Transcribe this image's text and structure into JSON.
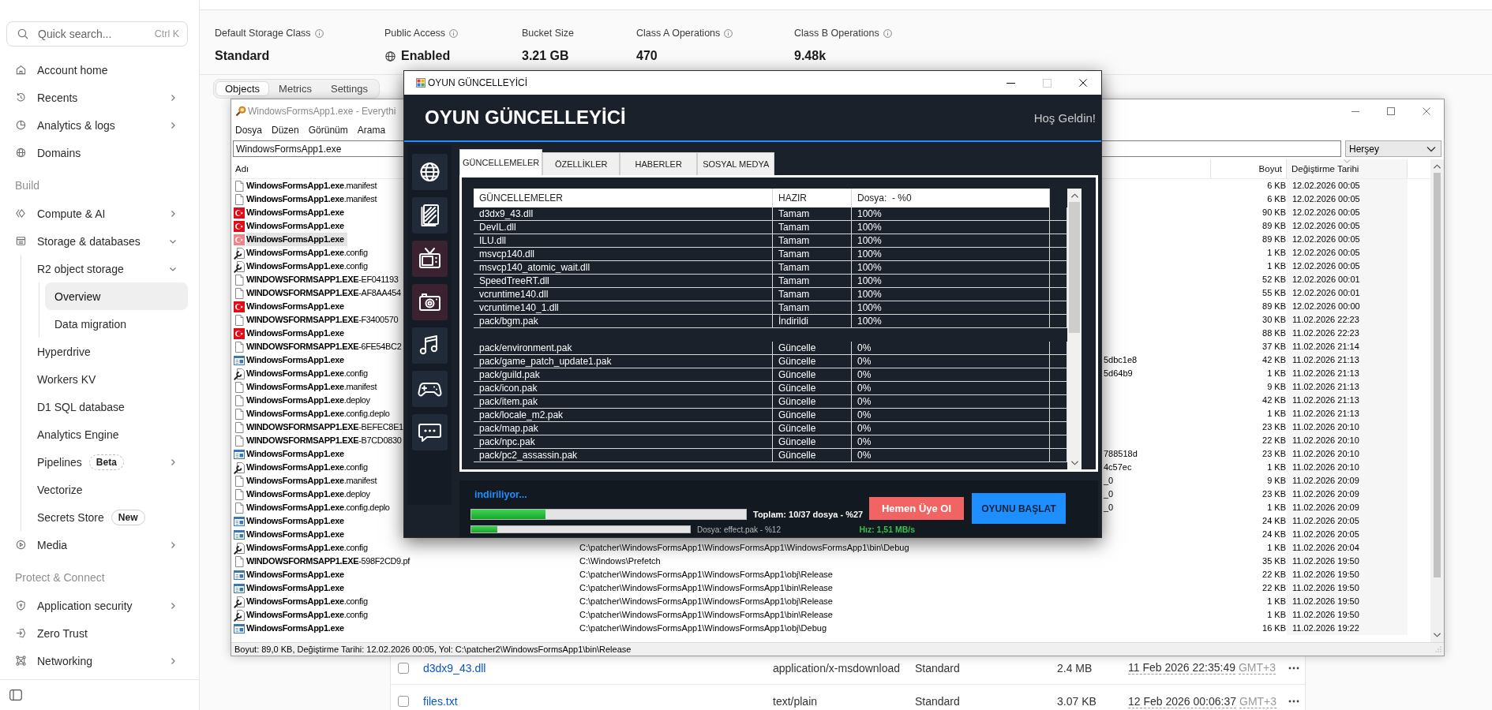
{
  "sidebar": {
    "search": {
      "placeholder": "Quick search...",
      "shortcut": "Ctrl K"
    },
    "sections": [
      {
        "items": [
          {
            "label": "Account home",
            "selected": false
          },
          {
            "label": "Recents",
            "selected": false,
            "expanded": false
          },
          {
            "label": "Analytics & logs",
            "selected": false,
            "expanded": false
          },
          {
            "label": "Domains",
            "selected": false
          }
        ]
      },
      {
        "heading": "Build",
        "items": [
          {
            "label": "Compute & AI",
            "selected": false,
            "expanded": false
          },
          {
            "label": "Storage & databases",
            "selected": false,
            "expanded": true,
            "children": [
              {
                "label": "R2 object storage",
                "selected": false,
                "expanded": true,
                "children": [
                  {
                    "label": "Overview",
                    "selected": true
                  },
                  {
                    "label": "Data migration",
                    "selected": false
                  }
                ]
              },
              {
                "label": "Hyperdrive",
                "selected": false
              },
              {
                "label": "Workers KV",
                "selected": false
              },
              {
                "label": "D1 SQL database",
                "selected": false
              },
              {
                "label": "Analytics Engine",
                "selected": false
              },
              {
                "label": "Pipelines",
                "selected": false,
                "expanded": false,
                "badge": {
                  "label": "Beta",
                  "kind": "dashed"
                }
              },
              {
                "label": "Vectorize",
                "selected": false
              },
              {
                "label": "Secrets Store",
                "selected": false,
                "badge": {
                  "label": "New",
                  "kind": "solid"
                }
              }
            ]
          },
          {
            "label": "Media",
            "selected": false,
            "expanded": false
          }
        ]
      },
      {
        "heading": "Protect & Connect",
        "items": [
          {
            "label": "Application security",
            "selected": false,
            "expanded": false
          },
          {
            "label": "Zero Trust",
            "selected": false
          },
          {
            "label": "Networking",
            "selected": false,
            "expanded": false
          }
        ]
      }
    ]
  },
  "main": {
    "stats": [
      {
        "label": "Default Storage Class",
        "info": true,
        "kind": "metric",
        "value": "Standard"
      },
      {
        "label": "Public Access",
        "info": true,
        "kind": "status",
        "value": "Enabled"
      },
      {
        "label": "Bucket Size",
        "info": false,
        "kind": "metric",
        "value": "3.21 GB"
      },
      {
        "label": "Class A Operations",
        "info": true,
        "kind": "metric",
        "value": "470"
      },
      {
        "label": "Class B Operations",
        "info": true,
        "kind": "metric",
        "value": "9.48k"
      }
    ],
    "tabs": [
      {
        "label": "Objects",
        "selected": true
      },
      {
        "label": "Metrics",
        "selected": false
      },
      {
        "label": "Settings",
        "selected": false
      }
    ],
    "objects": [
      {
        "checked": false,
        "name": "d3dx9_43.dll",
        "type": "application/x-msdownload",
        "storage_class": "Standard",
        "size": "2.4 MB",
        "modified": "11 Feb 2026 22:35:49",
        "timezone": "GMT+3"
      },
      {
        "checked": false,
        "name": "files.txt",
        "type": "text/plain",
        "storage_class": "Standard",
        "size": "3.07 KB",
        "modified": "12 Feb 2026 00:06:37",
        "timezone": "GMT+3"
      }
    ]
  },
  "everything_window": {
    "title": "WindowsFormsApp1.exe - Everythi",
    "menu": [
      "Dosya",
      "Düzen",
      "Görünüm",
      "Arama"
    ],
    "search": {
      "value": "WindowsFormsApp1.exe"
    },
    "filter": {
      "value": "Herşey"
    },
    "columns": [
      {
        "label": "Adı",
        "sorted": false
      },
      {
        "label": "Boyut",
        "sorted": false
      },
      {
        "label": "Değiştirme Tarihi",
        "sorted": true
      }
    ],
    "rows": [
      {
        "kind": "file",
        "name": "**WindowsFormsApp1.exe**.manifest",
        "all_bold": false,
        "size": "6 KB",
        "modified": "12.02.2026 00:05",
        "selected": false
      },
      {
        "kind": "file",
        "name": "**WindowsFormsApp1.exe**.manifest",
        "all_bold": false,
        "size": "6 KB",
        "modified": "12.02.2026 00:05",
        "selected": false
      },
      {
        "kind": "flag",
        "name": "WindowsFormsApp1.exe",
        "all_bold": true,
        "size": "90 KB",
        "modified": "12.02.2026 00:05",
        "selected": false
      },
      {
        "kind": "flag",
        "name": "WindowsFormsApp1.exe",
        "all_bold": true,
        "size": "89 KB",
        "modified": "12.02.2026 00:05",
        "selected": false
      },
      {
        "kind": "flag",
        "name": "WindowsFormsApp1.exe",
        "all_bold": true,
        "size": "89 KB",
        "modified": "12.02.2026 00:05",
        "selected": true
      },
      {
        "kind": "config",
        "name": "**WindowsFormsApp1.exe**.config",
        "all_bold": false,
        "size": "1 KB",
        "modified": "12.02.2026 00:05",
        "selected": false
      },
      {
        "kind": "config",
        "name": "**WindowsFormsApp1.exe**.config",
        "all_bold": false,
        "size": "1 KB",
        "modified": "12.02.2026 00:05",
        "selected": false
      },
      {
        "kind": "file",
        "name": "**WINDOWSFORMSAPP1.EXE**-EF041193",
        "all_bold": false,
        "size": "52 KB",
        "modified": "12.02.2026 00:01",
        "selected": false
      },
      {
        "kind": "file",
        "name": "**WINDOWSFORMSAPP1.EXE**-AF8AA454",
        "all_bold": false,
        "size": "55 KB",
        "modified": "12.02.2026 00:01",
        "selected": false
      },
      {
        "kind": "flag",
        "name": "WindowsFormsApp1.exe",
        "all_bold": true,
        "size": "89 KB",
        "modified": "12.02.2026 00:00",
        "selected": false
      },
      {
        "kind": "file",
        "name": "**WINDOWSFORMSAPP1.EXE**-F3400570",
        "all_bold": false,
        "size": "30 KB",
        "modified": "11.02.2026 22:23",
        "selected": false
      },
      {
        "kind": "flag",
        "name": "WindowsFormsApp1.exe",
        "all_bold": true,
        "size": "88 KB",
        "modified": "11.02.2026 22:23",
        "selected": false
      },
      {
        "kind": "file",
        "name": "**WINDOWSFORMSAPP1.EXE**-6FE54BC2",
        "all_bold": false,
        "size": "37 KB",
        "modified": "11.02.2026 21:14",
        "selected": false
      },
      {
        "kind": "app",
        "name": "WindowsFormsApp1.exe",
        "all_bold": true,
        "path_end": "5dbc1e8",
        "size": "42 KB",
        "modified": "11.02.2026 21:13",
        "selected": false
      },
      {
        "kind": "config",
        "name": "**WindowsFormsApp1.exe**.config",
        "all_bold": false,
        "path_end": "5d64b9",
        "size": "1 KB",
        "modified": "11.02.2026 21:13",
        "selected": false
      },
      {
        "kind": "file",
        "name": "**WindowsFormsApp1.exe**.manifest",
        "all_bold": false,
        "size": "9 KB",
        "modified": "11.02.2026 21:13",
        "selected": false
      },
      {
        "kind": "file",
        "name": "**WindowsFormsApp1.exe**.deploy",
        "all_bold": false,
        "size": "42 KB",
        "modified": "11.02.2026 21:13",
        "selected": false
      },
      {
        "kind": "file",
        "name": "**WindowsFormsApp1.exe**.config.deplo",
        "all_bold": false,
        "size": "1 KB",
        "modified": "11.02.2026 21:13",
        "selected": false
      },
      {
        "kind": "file",
        "name": "**WINDOWSFORMSAPP1.EXE**-BEFEC8E1",
        "all_bold": false,
        "size": "23 KB",
        "modified": "11.02.2026 20:10",
        "selected": false
      },
      {
        "kind": "file",
        "name": "**WINDOWSFORMSAPP1.EXE**-B7CD0830",
        "all_bold": false,
        "size": "22 KB",
        "modified": "11.02.2026 20:10",
        "selected": false
      },
      {
        "kind": "app",
        "name": "WindowsFormsApp1.exe",
        "all_bold": true,
        "path_end": "788518d",
        "size": "23 KB",
        "modified": "11.02.2026 20:10",
        "selected": false
      },
      {
        "kind": "config",
        "name": "**WindowsFormsApp1.exe**.config",
        "all_bold": false,
        "path_end": "4c57ec",
        "size": "1 KB",
        "modified": "11.02.2026 20:10",
        "selected": false
      },
      {
        "kind": "file",
        "name": "**WindowsFormsApp1.exe**.manifest",
        "all_bold": false,
        "path_end": "_0",
        "size": "9 KB",
        "modified": "11.02.2026 20:09",
        "selected": false
      },
      {
        "kind": "file",
        "name": "**WindowsFormsApp1.exe**.deploy",
        "all_bold": false,
        "path_end": "_0",
        "size": "23 KB",
        "modified": "11.02.2026 20:09",
        "selected": false
      },
      {
        "kind": "file",
        "name": "**WindowsFormsApp1.exe**.config.deplo",
        "all_bold": false,
        "path_end": "_0",
        "size": "1 KB",
        "modified": "11.02.2026 20:09",
        "selected": false
      },
      {
        "kind": "app",
        "name": "WindowsFormsApp1.exe",
        "all_bold": true,
        "size": "24 KB",
        "modified": "11.02.2026 20:05",
        "selected": false
      },
      {
        "kind": "app",
        "name": "WindowsFormsApp1.exe",
        "all_bold": true,
        "size": "24 KB",
        "modified": "11.02.2026 20:05",
        "selected": false
      },
      {
        "kind": "config",
        "name": "**WindowsFormsApp1.exe**.config",
        "all_bold": false,
        "path": "C:\\patcher\\WindowsFormsApp1\\WindowsFormsApp1\\WindowsFormsApp1\\bin\\Debug",
        "size": "1 KB",
        "modified": "11.02.2026 20:04",
        "selected": false
      },
      {
        "kind": "file",
        "name": "**WINDOWSFORMSAPP1.EXE**-598F2CD9.pf",
        "all_bold": false,
        "path": "C:\\Windows\\Prefetch",
        "size": "35 KB",
        "modified": "11.02.2026 19:50",
        "selected": false
      },
      {
        "kind": "app",
        "name": "WindowsFormsApp1.exe",
        "all_bold": true,
        "path": "C:\\patcher\\WindowsFormsApp1\\WindowsFormsApp1\\obj\\Release",
        "size": "22 KB",
        "modified": "11.02.2026 19:50",
        "selected": false
      },
      {
        "kind": "app",
        "name": "WindowsFormsApp1.exe",
        "all_bold": true,
        "path": "C:\\patcher\\WindowsFormsApp1\\WindowsFormsApp1\\bin\\Release",
        "size": "22 KB",
        "modified": "11.02.2026 19:50",
        "selected": false
      },
      {
        "kind": "config",
        "name": "**WindowsFormsApp1.exe**.config",
        "all_bold": false,
        "path": "C:\\patcher\\WindowsFormsApp1\\WindowsFormsApp1\\obj\\Release",
        "size": "1 KB",
        "modified": "11.02.2026 19:50",
        "selected": false
      },
      {
        "kind": "config",
        "name": "**WindowsFormsApp1.exe**.config",
        "all_bold": false,
        "path": "C:\\patcher\\WindowsFormsApp1\\WindowsFormsApp1\\bin\\Release",
        "size": "1 KB",
        "modified": "11.02.2026 19:50",
        "selected": false
      },
      {
        "kind": "app",
        "name": "WindowsFormsApp1.exe",
        "all_bold": true,
        "path": "C:\\patcher\\WindowsFormsApp1\\WindowsFormsApp1\\obj\\Debug",
        "size": "16 KB",
        "modified": "11.02.2026 19:22",
        "selected": false
      }
    ],
    "status_bar": "Boyut: 89,0 KB, Değiştirme Tarihi: 12.02.2026 00:05, Yol: C:\\patcher2\\WindowsFormsApp1\\bin\\Release"
  },
  "updater": {
    "title": "OYUN GÜNCELLEYİCİ",
    "maximize": {
      "disabled": true
    },
    "heading": "OYUN GÜNCELLEYİCİ",
    "greeting": "Hoş Geldin!",
    "nav": [
      {
        "highlighted": false
      },
      {
        "highlighted": false
      },
      {
        "highlighted": true
      },
      {
        "highlighted": true
      },
      {
        "highlighted": false
      },
      {
        "highlighted": false
      },
      {
        "highlighted": false
      }
    ],
    "tabs": [
      {
        "label": "GÜNCELLEMELER",
        "selected": true
      },
      {
        "label": "ÖZELLİKLER",
        "selected": false
      },
      {
        "label": "HABERLER",
        "selected": false
      },
      {
        "label": "SOSYAL MEDYA",
        "selected": false
      }
    ],
    "file_table": {
      "columns": [
        "GÜNCELLEMELER",
        "HAZIR",
        "Dosya:  - %0"
      ],
      "groups": [
        {
          "rows": [
            {
              "file": "d3dx9_43.dll",
              "status": "Tamam",
              "progress": "100%"
            },
            {
              "file": "DevIL.dll",
              "status": "Tamam",
              "progress": "100%"
            },
            {
              "file": "ILU.dll",
              "status": "Tamam",
              "progress": "100%"
            },
            {
              "file": "msvcp140.dll",
              "status": "Tamam",
              "progress": "100%"
            },
            {
              "file": "msvcp140_atomic_wait.dll",
              "status": "Tamam",
              "progress": "100%"
            },
            {
              "file": "SpeedTreeRT.dll",
              "status": "Tamam",
              "progress": "100%"
            },
            {
              "file": "vcruntime140.dll",
              "status": "Tamam",
              "progress": "100%"
            },
            {
              "file": "vcruntime140_1.dll",
              "status": "Tamam",
              "progress": "100%"
            },
            {
              "file": "pack/bgm.pak",
              "status": "İndirildi",
              "progress": "100%"
            }
          ]
        },
        {
          "rows": [
            {
              "file": "pack/environment.pak",
              "status": "Güncelle",
              "progress": "0%"
            },
            {
              "file": "pack/game_patch_update1.pak",
              "status": "Güncelle",
              "progress": "0%"
            },
            {
              "file": "pack/guild.pak",
              "status": "Güncelle",
              "progress": "0%"
            },
            {
              "file": "pack/icon.pak",
              "status": "Güncelle",
              "progress": "0%"
            },
            {
              "file": "pack/item.pak",
              "status": "Güncelle",
              "progress": "0%"
            },
            {
              "file": "pack/locale_m2.pak",
              "status": "Güncelle",
              "progress": "0%"
            },
            {
              "file": "pack/map.pak",
              "status": "Güncelle",
              "progress": "0%"
            },
            {
              "file": "pack/npc.pak",
              "status": "Güncelle",
              "progress": "0%"
            },
            {
              "file": "pack/pc2_assassin.pak",
              "status": "Güncelle",
              "progress": "0%"
            }
          ]
        }
      ]
    },
    "download": {
      "status": "indiriliyor...",
      "overall": {
        "level": 0.27,
        "text": "Toplam: 10/37 dosya - %27"
      },
      "current": {
        "level": 0.12,
        "text": "Dosya: effect.pak - %12"
      },
      "speed": "Hız: 1,51 MB/s"
    },
    "buttons": [
      {
        "label": "Hemen Üye Ol",
        "kind": "secondary"
      },
      {
        "label": "OYUNU BAŞLAT",
        "kind": "primary"
      }
    ]
  }
}
